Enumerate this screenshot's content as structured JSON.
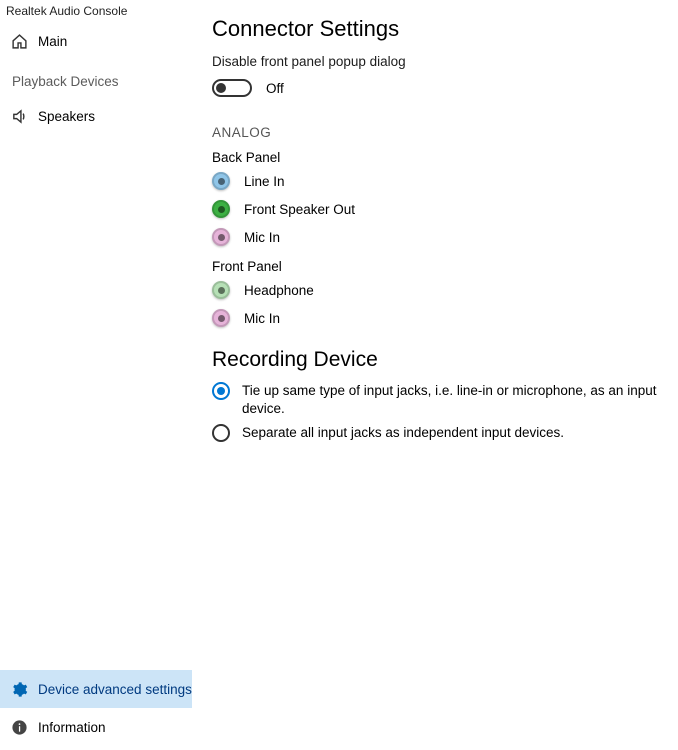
{
  "app_title": "Realtek Audio Console",
  "sidebar": {
    "main": "Main",
    "playback_header": "Playback Devices",
    "speakers": "Speakers",
    "device_adv": "Device advanced settings",
    "information": "Information"
  },
  "content": {
    "heading": "Connector Settings",
    "disable_popup_label": "Disable front panel popup dialog",
    "toggle_state": "Off",
    "analog_caption": "ANALOG",
    "back_panel": {
      "header": "Back Panel",
      "jacks": [
        {
          "label": "Line In",
          "color": "blue"
        },
        {
          "label": "Front Speaker Out",
          "color": "green"
        },
        {
          "label": "Mic In",
          "color": "pink"
        }
      ]
    },
    "front_panel": {
      "header": "Front Panel",
      "jacks": [
        {
          "label": "Headphone",
          "color": "lightgreen"
        },
        {
          "label": "Mic In",
          "color": "pink"
        }
      ]
    },
    "recording": {
      "heading": "Recording Device",
      "option1": "Tie up same type of input jacks, i.e. line-in or microphone, as an input device.",
      "option2": "Separate all input jacks as independent input devices.",
      "selected": 1
    }
  }
}
